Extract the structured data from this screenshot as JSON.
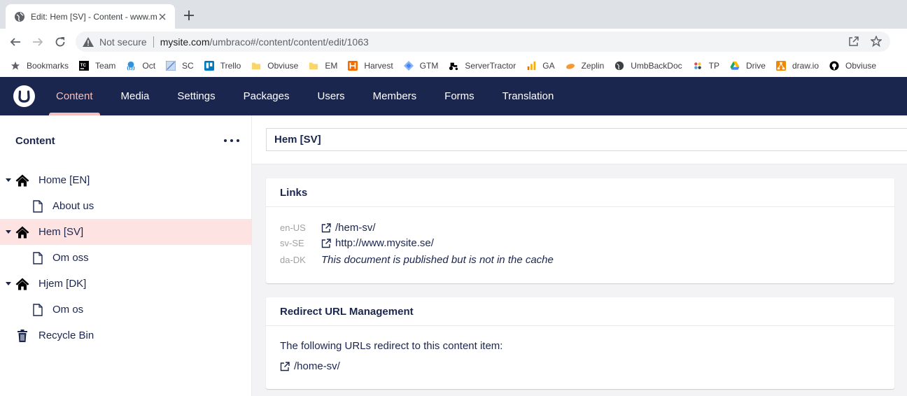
{
  "browser": {
    "tab_title": "Edit: Hem [SV] - Content - www.m",
    "not_secure": "Not secure",
    "url_host": "mysite.com",
    "url_path": "/umbraco#/content/content/edit/1063",
    "bookmarks": [
      {
        "label": "Bookmarks",
        "icon": "star-icon",
        "color": "#5f6368"
      },
      {
        "label": "Team",
        "icon": "tc-icon",
        "color": "#000000"
      },
      {
        "label": "Oct",
        "icon": "octopus-icon",
        "color": "#2f93e0"
      },
      {
        "label": "SC",
        "icon": "sc-icon",
        "color": "#5b87c5"
      },
      {
        "label": "Trello",
        "icon": "trello-icon",
        "color": "#0079bf"
      },
      {
        "label": "Obviuse",
        "icon": "folder-icon",
        "color": "#f9d56e"
      },
      {
        "label": "EM",
        "icon": "folder-icon",
        "color": "#f9d56e"
      },
      {
        "label": "Harvest",
        "icon": "harvest-icon",
        "color": "#f36c00"
      },
      {
        "label": "GTM",
        "icon": "gtm-icon",
        "color": "#4285f4"
      },
      {
        "label": "ServerTractor",
        "icon": "tractor-icon",
        "color": "#000000"
      },
      {
        "label": "GA",
        "icon": "analytics-icon",
        "color": "#f9ab00"
      },
      {
        "label": "Zeplin",
        "icon": "zeplin-icon",
        "color": "#f69833"
      },
      {
        "label": "UmbBackDoc",
        "icon": "globe-icon",
        "color": "#3c4043"
      },
      {
        "label": "TP",
        "icon": "tp-icon",
        "color": "#3c4043"
      },
      {
        "label": "Drive",
        "icon": "drive-icon",
        "color": "#1fa463"
      },
      {
        "label": "draw.io",
        "icon": "drawio-icon",
        "color": "#f08705"
      },
      {
        "label": "Obviuse",
        "icon": "github-icon",
        "color": "#000000"
      }
    ]
  },
  "header": {
    "sections": [
      "Content",
      "Media",
      "Settings",
      "Packages",
      "Users",
      "Members",
      "Forms",
      "Translation"
    ],
    "active": "Content"
  },
  "tree": {
    "title": "Content",
    "nodes": [
      {
        "label": "Home [EN]",
        "icon": "home-icon",
        "level": 0,
        "expanded": true
      },
      {
        "label": "About us",
        "icon": "document-icon",
        "level": 1
      },
      {
        "label": "Hem [SV]",
        "icon": "home-icon",
        "level": 0,
        "expanded": true,
        "selected": true
      },
      {
        "label": "Om oss",
        "icon": "document-icon",
        "level": 1
      },
      {
        "label": "Hjem [DK]",
        "icon": "home-icon",
        "level": 0,
        "expanded": true
      },
      {
        "label": "Om os",
        "icon": "document-icon",
        "level": 1
      },
      {
        "label": "Recycle Bin",
        "icon": "trash-icon",
        "level": 0
      }
    ]
  },
  "editor": {
    "name": "Hem [SV]",
    "links_title": "Links",
    "links": [
      {
        "lang": "en-US",
        "url": "/hem-sv/"
      },
      {
        "lang": "sv-SE",
        "url": "http://www.mysite.se/"
      },
      {
        "lang": "da-DK",
        "note": "This document is published but is not in the cache"
      }
    ],
    "redirect_title": "Redirect URL Management",
    "redirect_text": "The following URLs redirect to this content item:",
    "redirect_url": "/home-sv/"
  },
  "colors": {
    "header_bg": "#1b264f",
    "active_section": "#f5c1bc",
    "selected_node_bg": "#fde4e2",
    "text": "#1b264f"
  }
}
